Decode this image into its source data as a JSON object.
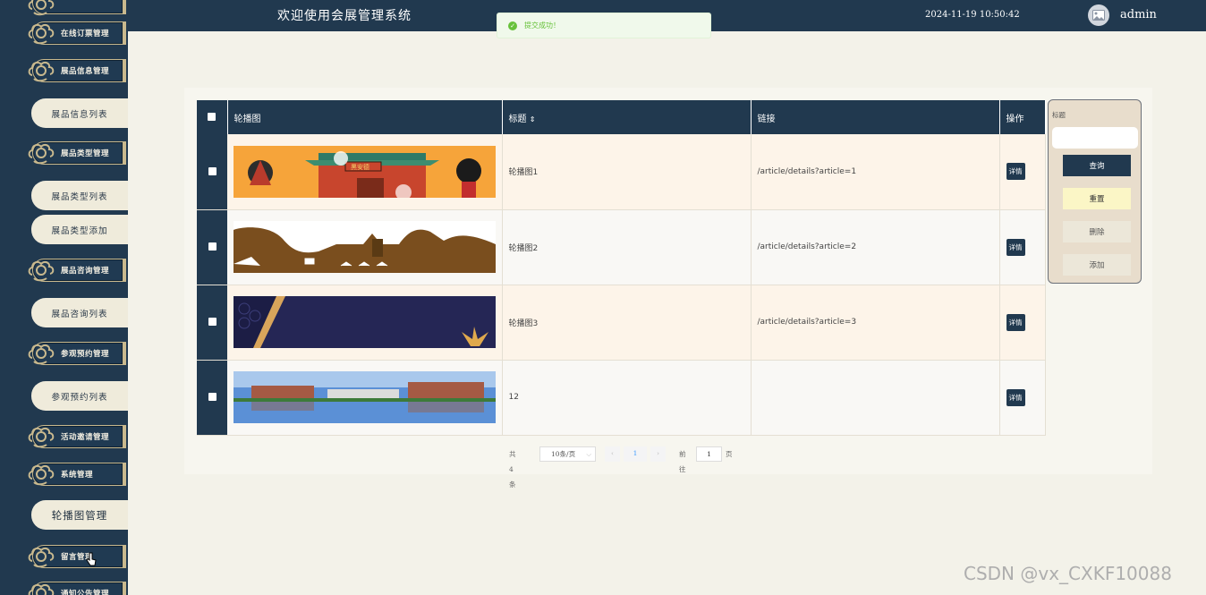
{
  "header": {
    "title": "欢迎使用会展管理系统",
    "datetime": "2024-11-19 10:50:42",
    "user": "admin"
  },
  "toast": {
    "message": "提交成功！"
  },
  "sidebar": {
    "groups": [
      {
        "label": "在线订票管理"
      },
      {
        "label": "展品信息管理"
      },
      {
        "label": "展品类型管理"
      },
      {
        "label": "展品咨询管理"
      },
      {
        "label": "参观预约管理"
      },
      {
        "label": "活动邀请管理"
      },
      {
        "label": "系统管理"
      },
      {
        "label": "留言管理"
      },
      {
        "label": "通知公告管理"
      }
    ],
    "subs": [
      {
        "label": "展品信息列表"
      },
      {
        "label": "展品类型列表"
      },
      {
        "label": "展品类型添加"
      },
      {
        "label": "展品咨询列表"
      },
      {
        "label": "参观预约列表"
      },
      {
        "label": "轮播图管理"
      }
    ]
  },
  "table": {
    "columns": {
      "image": "轮播图",
      "title": "标题",
      "sort_icon": "⇕",
      "link": "链接",
      "action": "操作"
    },
    "rows": [
      {
        "title": "轮播图1",
        "link": "/article/details?article=1",
        "action": "详情"
      },
      {
        "title": "轮播图2",
        "link": "/article/details?article=2",
        "action": "详情"
      },
      {
        "title": "轮播图3",
        "link": "/article/details?article=3",
        "action": "详情"
      },
      {
        "title": "12",
        "link": "",
        "action": "详情"
      }
    ],
    "banner1_sign": "黑安德"
  },
  "pager": {
    "total": "共 4 条",
    "page_size": "10条/页",
    "prev": "‹",
    "current": "1",
    "next": "›",
    "goto_prefix": "前往",
    "goto_value": "1",
    "goto_suffix": "页"
  },
  "search": {
    "label": "标题",
    "query": "查询",
    "reset": "重置",
    "delete": "删除",
    "add": "添加"
  },
  "watermark": "CSDN @vx_CXKF10088"
}
